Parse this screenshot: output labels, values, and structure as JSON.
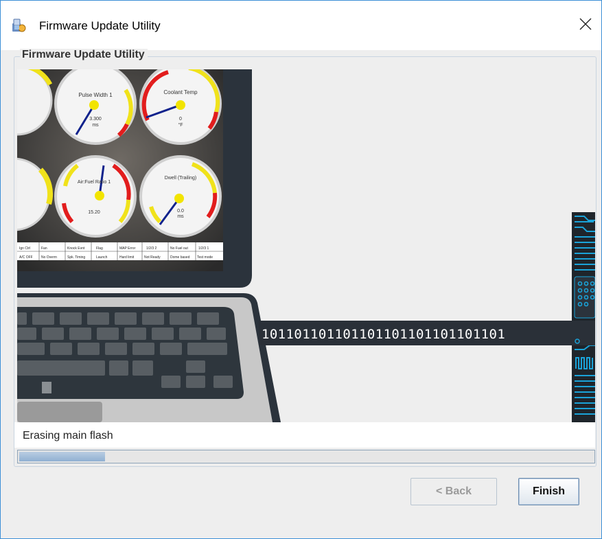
{
  "window": {
    "title": "Firmware Update Utility",
    "close_label": "✕"
  },
  "panel": {
    "legend": "Firmware Update Utility"
  },
  "illustration": {
    "binary_text": "101101101101101101101101101101",
    "gauges": [
      {
        "label": "Pulse Width 1",
        "value": "3.300",
        "unit": "ms"
      },
      {
        "label": "Coolant Temp",
        "value": "0",
        "unit": "°F"
      },
      {
        "label": "Air:Fuel Ratio 1",
        "value": "15.20",
        "unit": ""
      },
      {
        "label": "Dwell (Trailing)",
        "value": "0.0",
        "unit": "ms"
      }
    ],
    "status_cells_top": [
      "Ign Ctrl",
      "Fan",
      "Knock Evnt",
      "Flag",
      "MAP Error",
      "1/2/3 2",
      "No Fuel out",
      "1/2/3 1"
    ],
    "status_cells_bottom": [
      "A/C OFF",
      "No Overrn",
      "Spk. Timing",
      "Launch",
      "Hard limit",
      "Not Ready",
      "Dome based",
      "Test mode"
    ],
    "colors": {
      "laptop_bezel": "#2b333c",
      "laptop_body": "#c8c8c8",
      "chip_accent": "#1aa3d9",
      "gauge_red": "#e21d1d",
      "gauge_yellow": "#f0e21b",
      "needle": "#10228c"
    }
  },
  "status": {
    "message": "Erasing main flash"
  },
  "progress": {
    "fraction": 0.15
  },
  "buttons": {
    "back_label": "< Back",
    "finish_label": "Finish"
  }
}
